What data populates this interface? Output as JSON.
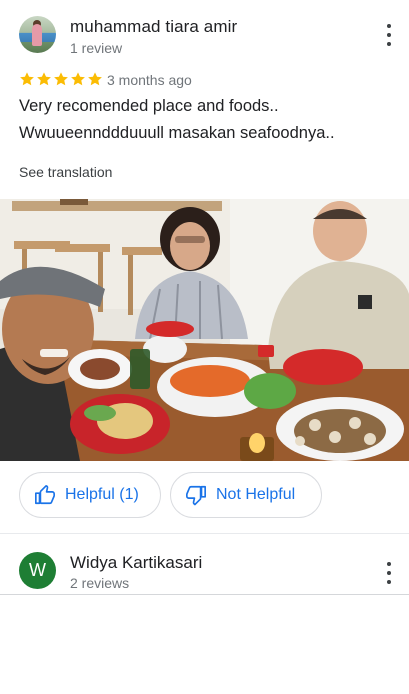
{
  "review": {
    "reviewer_name": "muhammad tiara amir",
    "reviewer_meta": "1 review",
    "rating": 5,
    "time": "3 months ago",
    "text_line1": "Very recomended place and foods..",
    "text_line2": "Wwuueennddduuull masakan seafoodnya..",
    "see_translation": "See translation",
    "helpful_label": "Helpful (1)",
    "not_helpful_label": "Not Helpful"
  },
  "next_review": {
    "avatar_letter": "W",
    "reviewer_name": "Widya Kartikasari",
    "reviewer_meta": "2 reviews"
  },
  "colors": {
    "star": "#fbbc04",
    "link_blue": "#1a73e8",
    "avatar_green": "#1e7e34"
  },
  "icons": {
    "more": "more-vert-icon",
    "thumb_up": "thumb-up-icon",
    "thumb_down": "thumb-down-icon",
    "star": "star-icon"
  }
}
